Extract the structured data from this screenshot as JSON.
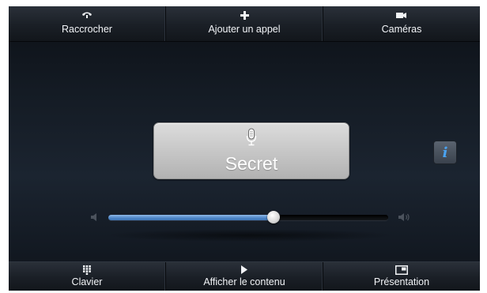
{
  "top_toolbar": {
    "items": [
      {
        "label": "Raccrocher",
        "icon": "hang-up-icon"
      },
      {
        "label": "Ajouter un appel",
        "icon": "plus-icon"
      },
      {
        "label": "Caméras",
        "icon": "camera-icon"
      }
    ]
  },
  "bottom_toolbar": {
    "items": [
      {
        "label": "Clavier",
        "icon": "keypad-icon"
      },
      {
        "label": "Afficher le contenu",
        "icon": "play-icon"
      },
      {
        "label": "Présentation",
        "icon": "presentation-icon"
      }
    ]
  },
  "mute_button": {
    "label": "Secret",
    "icon": "microphone-icon"
  },
  "info_button": {
    "glyph": "i",
    "icon": "info-icon",
    "color": "#4aa3f2"
  },
  "volume": {
    "level": 0.59,
    "accent": "#4d86c8"
  }
}
